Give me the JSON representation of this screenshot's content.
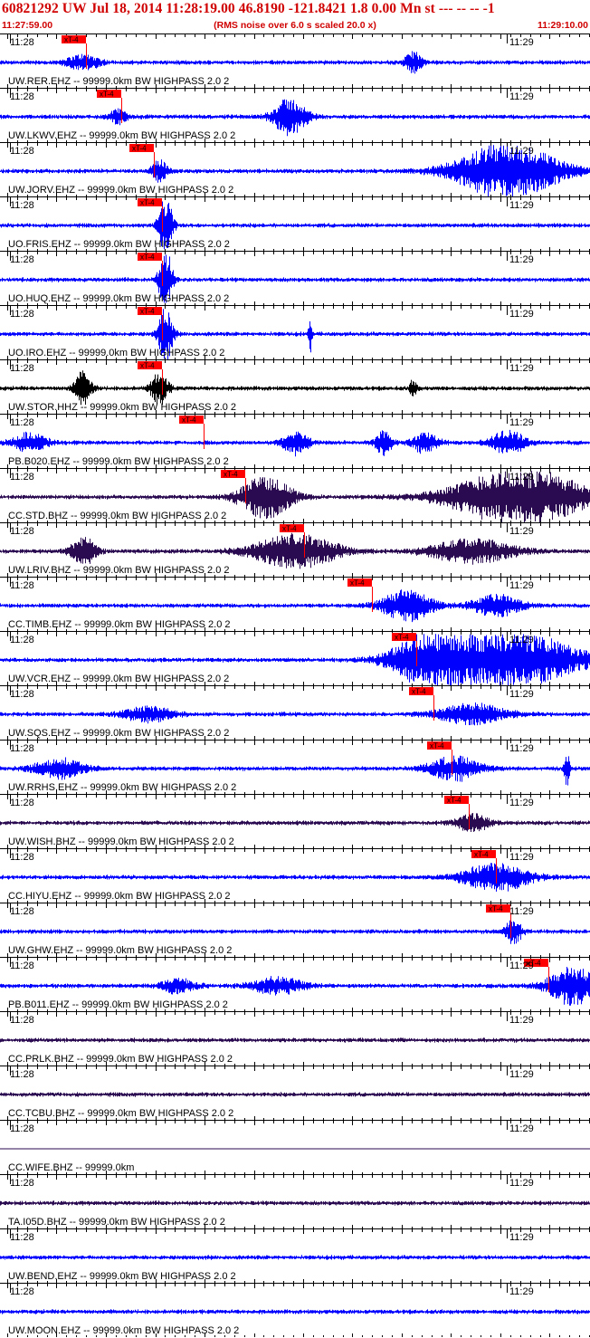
{
  "header": {
    "title": "60821292 UW Jul 18, 2014 11:28:19.00   46.8190 -121.8421  1.8 0.00 Mn st --- -- --  -1",
    "start_time": "11:27:59.00",
    "noise_note": "(RMS noise over 6.0 s scaled 20.0 x)",
    "end_time": "11:29:10.00"
  },
  "pick_label": "xT-4",
  "time_ticks": {
    "left": "11:28",
    "right": "11:29"
  },
  "colors": {
    "header_text": "#d00000",
    "trace_blue": "#0000ff",
    "trace_dark": "#2a0a50",
    "trace_black": "#000000",
    "pick": "#ff0000"
  },
  "traces": [
    {
      "label": "UW.RER.EHZ -- 99999.0km BW  HIGHPASS  2.0  2",
      "color": "blue",
      "pick": 0.145,
      "bursts": [
        [
          0.14,
          0.02,
          0.3
        ],
        [
          0.7,
          0.01,
          0.45
        ]
      ]
    },
    {
      "label": "UW.LKWV.EHZ -- 99999.0km BW  HIGHPASS  2.0  2",
      "color": "blue",
      "pick": 0.205,
      "bursts": [
        [
          0.2,
          0.01,
          0.3
        ],
        [
          0.49,
          0.02,
          0.75
        ]
      ]
    },
    {
      "label": "UW.JORV.EHZ -- 99999.0km BW  HIGHPASS  2.0  2",
      "color": "blue",
      "pick": 0.26,
      "bursts": [
        [
          0.27,
          0.01,
          0.45
        ],
        [
          0.86,
          0.06,
          1.2
        ]
      ]
    },
    {
      "label": "UO.FRIS.EHZ -- 99999.0km BW  HIGHPASS  2.0  2",
      "color": "blue",
      "pick": 0.275,
      "bursts": [
        [
          0.28,
          0.008,
          1.3
        ]
      ]
    },
    {
      "label": "UO.HUQ.EHZ -- 99999.0km BW  HIGHPASS  2.0  2",
      "color": "blue",
      "pick": 0.275,
      "bursts": [
        [
          0.28,
          0.008,
          1.3
        ]
      ]
    },
    {
      "label": "UO.IRO.EHZ -- 99999.0km BW  HIGHPASS  2.0  2",
      "color": "blue",
      "pick": 0.275,
      "bursts": [
        [
          0.28,
          0.008,
          1.3
        ],
        [
          0.525,
          0.002,
          0.8
        ]
      ]
    },
    {
      "label": "UW.STOR.HHZ -- 99999.0km BW  HIGHPASS  2.0  2",
      "color": "black",
      "pick": 0.275,
      "bursts": [
        [
          0.14,
          0.01,
          0.7
        ],
        [
          0.27,
          0.01,
          0.7
        ],
        [
          0.7,
          0.004,
          0.4
        ]
      ]
    },
    {
      "label": "PB.B020.EHZ -- 99999.0km BW  HIGHPASS  2.0  2",
      "color": "blue",
      "pick": 0.345,
      "bursts": [
        [
          0.05,
          0.02,
          0.4
        ],
        [
          0.5,
          0.015,
          0.5
        ],
        [
          0.65,
          0.01,
          0.5
        ],
        [
          0.72,
          0.015,
          0.45
        ],
        [
          0.86,
          0.02,
          0.5
        ]
      ]
    },
    {
      "label": "CC.STD.BHZ -- 99999.0km BW  HIGHPASS  2.0  2",
      "color": "dark",
      "pick": 0.415,
      "bursts": [
        [
          0.45,
          0.03,
          0.9
        ],
        [
          0.88,
          0.08,
          1.2
        ]
      ]
    },
    {
      "label": "UW.LRIV.BHZ -- 99999.0km BW  HIGHPASS  2.0  2",
      "color": "dark",
      "pick": 0.515,
      "bursts": [
        [
          0.14,
          0.015,
          0.6
        ],
        [
          0.5,
          0.05,
          0.7
        ],
        [
          0.8,
          0.05,
          0.5
        ]
      ]
    },
    {
      "label": "CC.TIMB.EHZ -- 99999.0km BW  HIGHPASS  2.0  2",
      "color": "blue",
      "pick": 0.63,
      "bursts": [
        [
          0.69,
          0.03,
          0.65
        ],
        [
          0.84,
          0.03,
          0.45
        ]
      ]
    },
    {
      "label": "UW.VCR.EHZ -- 99999.0km BW  HIGHPASS  2.0  2",
      "color": "blue",
      "pick": 0.705,
      "bursts": [
        [
          0.72,
          0.04,
          1.0
        ],
        [
          0.86,
          0.08,
          1.3
        ]
      ]
    },
    {
      "label": "UW.SQS.EHZ -- 99999.0km BW  HIGHPASS  2.0  2",
      "color": "blue",
      "pick": 0.735,
      "bursts": [
        [
          0.25,
          0.03,
          0.3
        ],
        [
          0.8,
          0.04,
          0.45
        ]
      ]
    },
    {
      "label": "UW.RRHS.EHZ -- 99999.0km BW  HIGHPASS  2.0  2",
      "color": "blue",
      "pick": 0.765,
      "bursts": [
        [
          0.1,
          0.03,
          0.4
        ],
        [
          0.77,
          0.03,
          0.5
        ],
        [
          0.96,
          0.003,
          0.8
        ]
      ]
    },
    {
      "label": "UW.WISH.BHZ -- 99999.0km BW  HIGHPASS  2.0  2",
      "color": "dark",
      "pick": 0.795,
      "bursts": [
        [
          0.8,
          0.02,
          0.35
        ]
      ]
    },
    {
      "label": "CC.HIYU.EHZ -- 99999.0km BW  HIGHPASS  2.0  2",
      "color": "blue",
      "pick": 0.84,
      "bursts": [
        [
          0.84,
          0.04,
          0.6
        ]
      ]
    },
    {
      "label": "UW.GHW.EHZ -- 99999.0km BW  HIGHPASS  2.0  2",
      "color": "blue",
      "pick": 0.865,
      "bursts": [
        [
          0.87,
          0.01,
          0.5
        ]
      ]
    },
    {
      "label": "PB.B011.EHZ -- 99999.0km BW  HIGHPASS  2.0  2",
      "color": "blue",
      "pick": 0.93,
      "bursts": [
        [
          0.3,
          0.02,
          0.3
        ],
        [
          0.47,
          0.03,
          0.35
        ],
        [
          0.97,
          0.03,
          0.8
        ]
      ]
    },
    {
      "label": "CC.PRLK.BHZ -- 99999.0km BW  HIGHPASS  2.0  2",
      "color": "dark",
      "pick": null,
      "bursts": []
    },
    {
      "label": "CC.TCBU.BHZ -- 99999.0km BW  HIGHPASS  2.0  2",
      "color": "dark",
      "pick": null,
      "bursts": []
    },
    {
      "label": "CC.WIFE.BHZ -- 99999.0km",
      "color": "dark",
      "pick": null,
      "bursts": [],
      "flat": true
    },
    {
      "label": "TA.I05D.BHZ -- 99999.0km BW  HIGHPASS  2.0  2",
      "color": "dark",
      "pick": null,
      "bursts": []
    },
    {
      "label": "UW.BEND.EHZ -- 99999.0km BW  HIGHPASS  2.0  2",
      "color": "blue",
      "pick": null,
      "bursts": []
    },
    {
      "label": "UW.MOON.EHZ -- 99999.0km BW  HIGHPASS  2.0  2",
      "color": "blue",
      "pick": null,
      "bursts": []
    }
  ]
}
